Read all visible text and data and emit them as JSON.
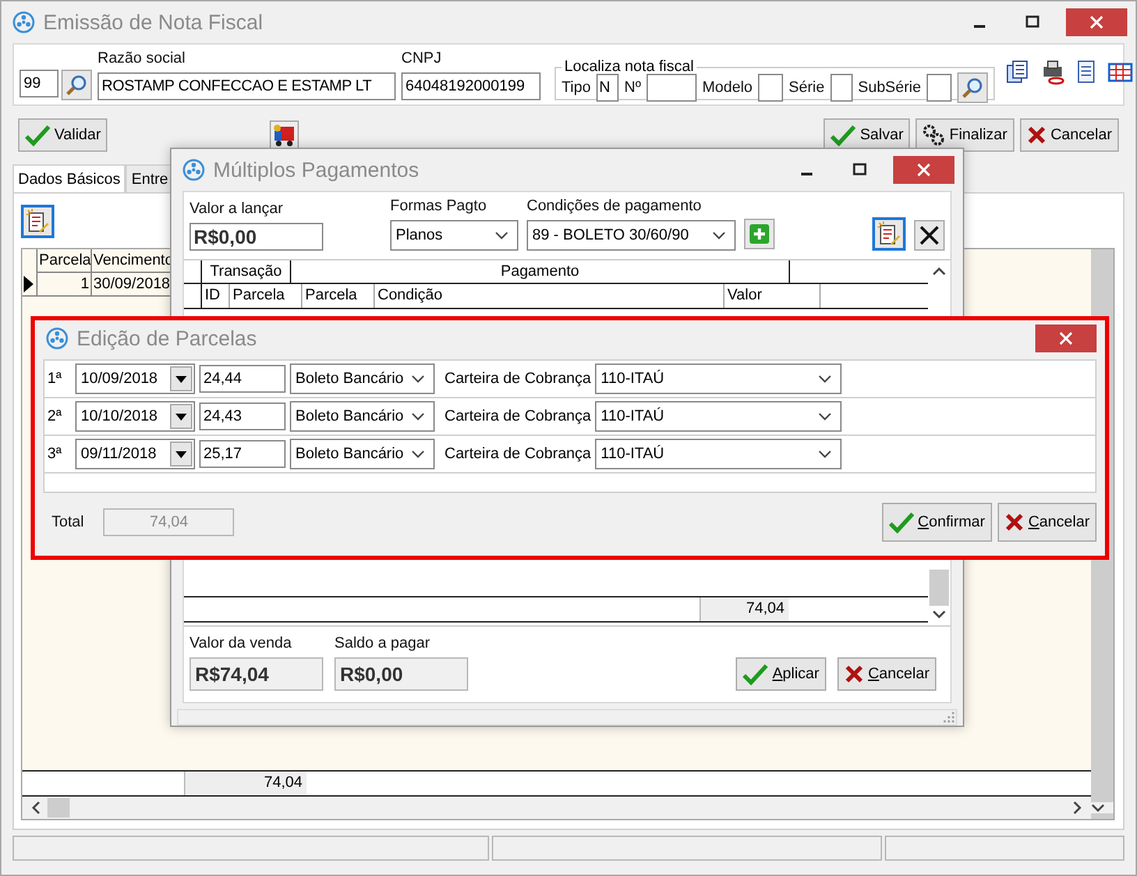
{
  "main_window": {
    "title": "Emissão de Nota Fiscal",
    "customer": {
      "code": "99",
      "razao_label": "Razão social",
      "razao_value": "ROSTAMP CONFECCAO E ESTAMP LT",
      "cnpj_label": "CNPJ",
      "cnpj_value": "64048192000199"
    },
    "locate": {
      "title": "Localiza nota fiscal",
      "tipo_label": "Tipo",
      "tipo_value": "N",
      "numero_label": "Nº",
      "modelo_label": "Modelo",
      "serie_label": "Série",
      "subserie_label": "SubSérie"
    },
    "buttons": {
      "validar": "Validar",
      "salvar": "Salvar",
      "finalizar": "Finalizar",
      "cancelar": "Cancelar"
    },
    "tabs": [
      {
        "label": "Dados Básicos",
        "selected": true
      },
      {
        "label": "Entre",
        "selected": false
      }
    ],
    "grid": {
      "columns": [
        "Parcela",
        "Vencimento"
      ],
      "rows": [
        {
          "parcela": "1",
          "vencimento": "30/09/2018",
          "current": true
        }
      ],
      "total": "74,04"
    }
  },
  "payments_dialog": {
    "title": "Múltiplos Pagamentos",
    "valor_label": "Valor a lançar",
    "valor": "R$0,00",
    "formas_label": "Formas Pagto",
    "formas": "Planos",
    "condicoes_label": "Condições de pagamento",
    "condicoes": "89 - BOLETO 30/60/90",
    "grid": {
      "groups": [
        "Transação",
        "Pagamento"
      ],
      "columns": [
        "ID",
        "Parcela",
        "Parcela",
        "Condição",
        "Valor"
      ],
      "total": "74,04"
    },
    "venda_label": "Valor da venda",
    "venda": "R$74,04",
    "saldo_label": "Saldo a pagar",
    "saldo": "R$0,00",
    "aplicar": "Aplicar",
    "cancelar": "Cancelar"
  },
  "installments_dialog": {
    "title": "Edição de Parcelas",
    "rows": [
      {
        "number": "1ª",
        "date": "10/09/2018",
        "value": "24,44",
        "forma": "Boleto Bancário",
        "carteira_label": "Carteira de Cobrança",
        "carteira": "110-ITAÚ"
      },
      {
        "number": "2ª",
        "date": "10/10/2018",
        "value": "24,43",
        "forma": "Boleto Bancário",
        "carteira_label": "Carteira de Cobrança",
        "carteira": "110-ITAÚ"
      },
      {
        "number": "3ª",
        "date": "09/11/2018",
        "value": "25,17",
        "forma": "Boleto Bancário",
        "carteira_label": "Carteira de Cobrança",
        "carteira": "110-ITAÚ"
      }
    ],
    "total_label": "Total",
    "total": "74,04",
    "confirmar": "Confirmar",
    "cancelar": "Cancelar"
  }
}
